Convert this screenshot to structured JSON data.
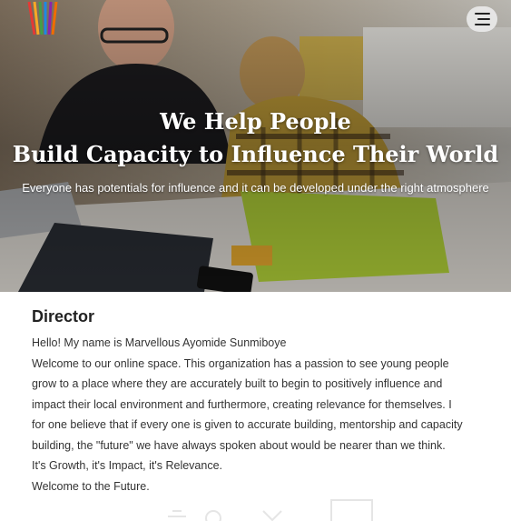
{
  "hero": {
    "title_line1": "We Help People",
    "title_line2": "Build Capacity to Influence Their World",
    "subtitle": "Everyone has potentials for influence and it can be developed under the right atmosphere"
  },
  "header": {
    "logo_icon": "colorful-stripes-logo",
    "menu_icon": "hamburger-menu-icon"
  },
  "director": {
    "heading": "Director",
    "lines": [
      "Hello! My name is Marvellous Ayomide Sunmiboye",
      "Welcome to our online space. This organization has a passion to see young people",
      "grow to a place where they are accurately built to begin to positively influence and",
      "impact their local environment and furthermore, creating relevance for themselves. I",
      "for one believe that if every one is given to accurate building, mentorship and capacity",
      "building, the \"future\" we have always spoken about would be nearer than we think.",
      "It's Growth, it's Impact, it's Relevance.",
      "Welcome to the Future."
    ]
  }
}
